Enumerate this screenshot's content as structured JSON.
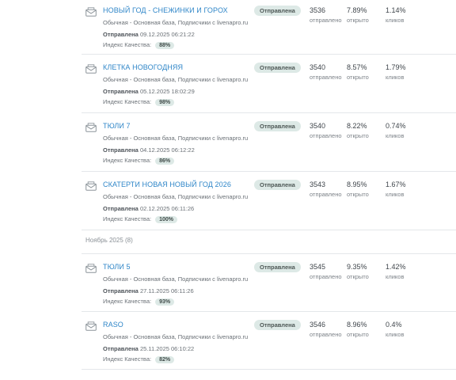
{
  "campaigns_top": [
    {
      "title": "НОВЫЙ ГОД - СНЕЖИНКИ И ГОРОХ",
      "subtitle": "Обычная - Основная база, Подписчики с livenapro.ru",
      "sent_label": "Отправлена",
      "sent_date": "09.12.2025 06:21:22",
      "quality_label": "Индекс Качества:",
      "quality": "88%",
      "status": "Отправлена",
      "sent_count": "3536",
      "sent_count_label": "отправлено",
      "open_rate": "7.89%",
      "open_label": "открыто",
      "click_rate": "1.14%",
      "click_label": "кликов"
    },
    {
      "title": "КЛЕТКА НОВОГОДНЯЯ",
      "subtitle": "Обычная - Основная база, Подписчики с livenapro.ru",
      "sent_label": "Отправлена",
      "sent_date": "05.12.2025 18:02:29",
      "quality_label": "Индекс Качества:",
      "quality": "98%",
      "status": "Отправлена",
      "sent_count": "3540",
      "sent_count_label": "отправлено",
      "open_rate": "8.57%",
      "open_label": "открыто",
      "click_rate": "1.79%",
      "click_label": "кликов"
    },
    {
      "title": "ТЮЛИ 7",
      "subtitle": "Обычная - Основная база, Подписчики с livenapro.ru",
      "sent_label": "Отправлена",
      "sent_date": "04.12.2025 06:12:22",
      "quality_label": "Индекс Качества:",
      "quality": "86%",
      "status": "Отправлена",
      "sent_count": "3540",
      "sent_count_label": "отправлено",
      "open_rate": "8.22%",
      "open_label": "открыто",
      "click_rate": "0.74%",
      "click_label": "кликов"
    },
    {
      "title": "СКАТЕРТИ НОВАЯ НОВЫЙ ГОД 2026",
      "subtitle": "Обычная - Основная база, Подписчики с livenapro.ru",
      "sent_label": "Отправлена",
      "sent_date": "02.12.2025 06:11:26",
      "quality_label": "Индекс Качества:",
      "quality": "100%",
      "status": "Отправлена",
      "sent_count": "3543",
      "sent_count_label": "отправлено",
      "open_rate": "8.95%",
      "open_label": "открыто",
      "click_rate": "1.67%",
      "click_label": "кликов"
    }
  ],
  "section": {
    "title": "Ноябрь 2025 (8)"
  },
  "campaigns_bottom": [
    {
      "title": "ТЮЛИ 5",
      "subtitle": "Обычная - Основная база, Подписчики с livenapro.ru",
      "sent_label": "Отправлена",
      "sent_date": "27.11.2025 06:11:26",
      "quality_label": "Индекс Качества:",
      "quality": "93%",
      "status": "Отправлена",
      "sent_count": "3545",
      "sent_count_label": "отправлено",
      "open_rate": "9.35%",
      "open_label": "открыто",
      "click_rate": "1.42%",
      "click_label": "кликов"
    },
    {
      "title": "RASO",
      "subtitle": "Обычная - Основная база, Подписчики с livenapro.ru",
      "sent_label": "Отправлена",
      "sent_date": "25.11.2025 06:10:22",
      "quality_label": "Индекс Качества:",
      "quality": "82%",
      "status": "Отправлена",
      "sent_count": "3546",
      "sent_count_label": "отправлено",
      "open_rate": "8.96%",
      "open_label": "открыто",
      "click_rate": "0.4%",
      "click_label": "кликов"
    }
  ],
  "colors": {
    "link": "#2f86c8",
    "badge_bg": "#dde9e6",
    "divider": "#e4e7ea"
  },
  "icons": {
    "campaign": "envelope-icon"
  }
}
